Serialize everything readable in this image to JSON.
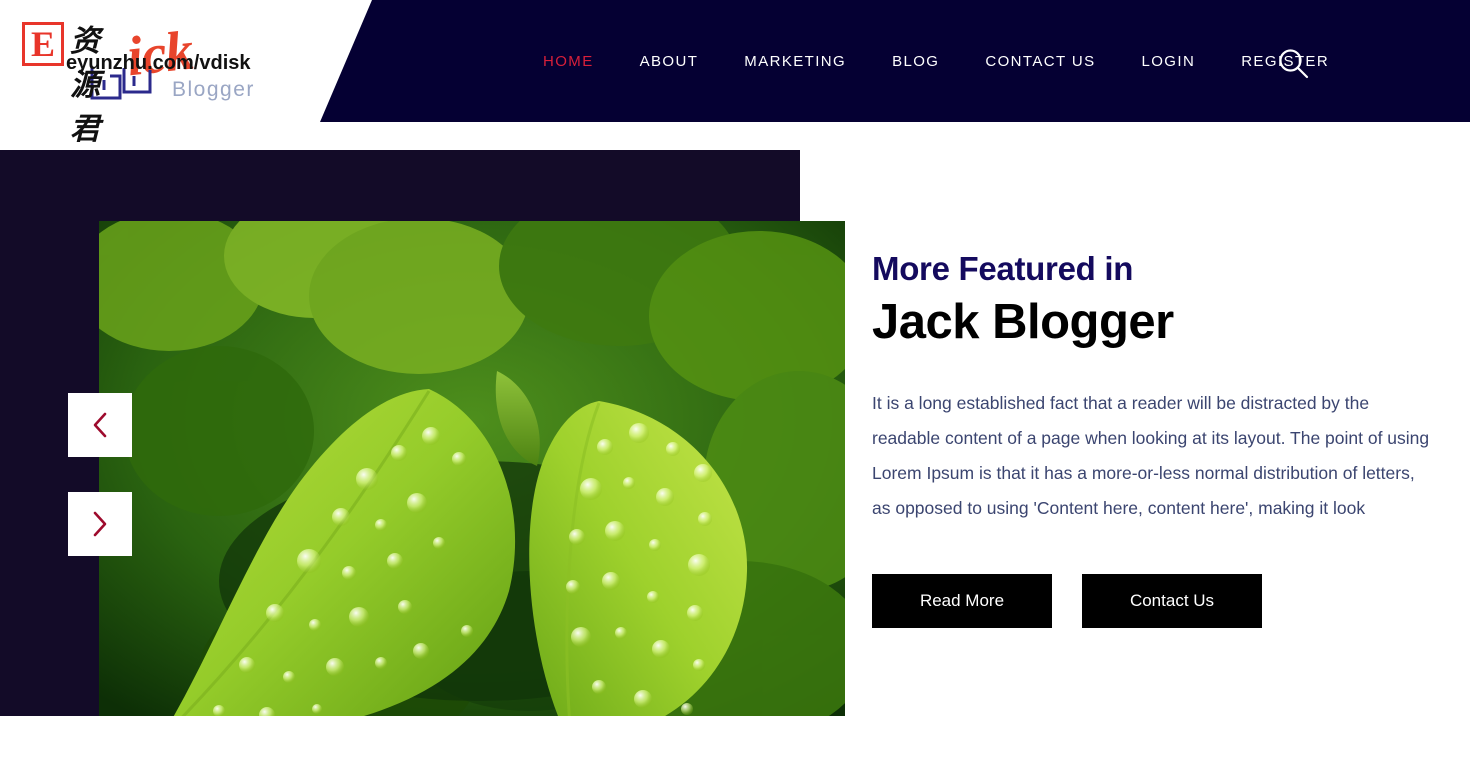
{
  "header": {
    "logo": {
      "brand_text": "ick",
      "sub_text": "Blogger",
      "mark_icon": "blogger-logo-icon"
    },
    "watermark": {
      "badge_letter": "E",
      "cn_text": "资源君",
      "url_text": "eyunzhu.com/vdisk"
    },
    "nav": [
      {
        "label": "HOME",
        "active": true
      },
      {
        "label": "ABOUT",
        "active": false
      },
      {
        "label": "MARKETING",
        "active": false
      },
      {
        "label": "BLOG",
        "active": false
      },
      {
        "label": "CONTACT US",
        "active": false
      },
      {
        "label": "LOGIN",
        "active": false
      },
      {
        "label": "REGISTER",
        "active": false
      }
    ],
    "search_icon": "search-icon"
  },
  "hero": {
    "slider": {
      "prev_icon": "chevron-left-icon",
      "next_icon": "chevron-right-icon",
      "image_alt": "green-leaves-with-water-drops"
    },
    "eyebrow": "More Featured in",
    "title": "Jack Blogger",
    "paragraph": "It is a long established fact that a reader will be distracted by the readable content of a page when looking at its layout. The point of using Lorem Ipsum is that it has a more-or-less normal distribution of letters, as opposed to using 'Content here, content here', making it look",
    "buttons": [
      {
        "label": "Read More"
      },
      {
        "label": "Contact Us"
      }
    ]
  },
  "colors": {
    "header_navy": "#050033",
    "hero_navy": "#130B28",
    "accent_red": "#d81f3a",
    "eyebrow_navy": "#140a5e",
    "paragraph_slate": "#3b4570",
    "button_black": "#000000",
    "logo_orange": "#e8452c",
    "logo_sub_grey": "#9aa6c4"
  }
}
